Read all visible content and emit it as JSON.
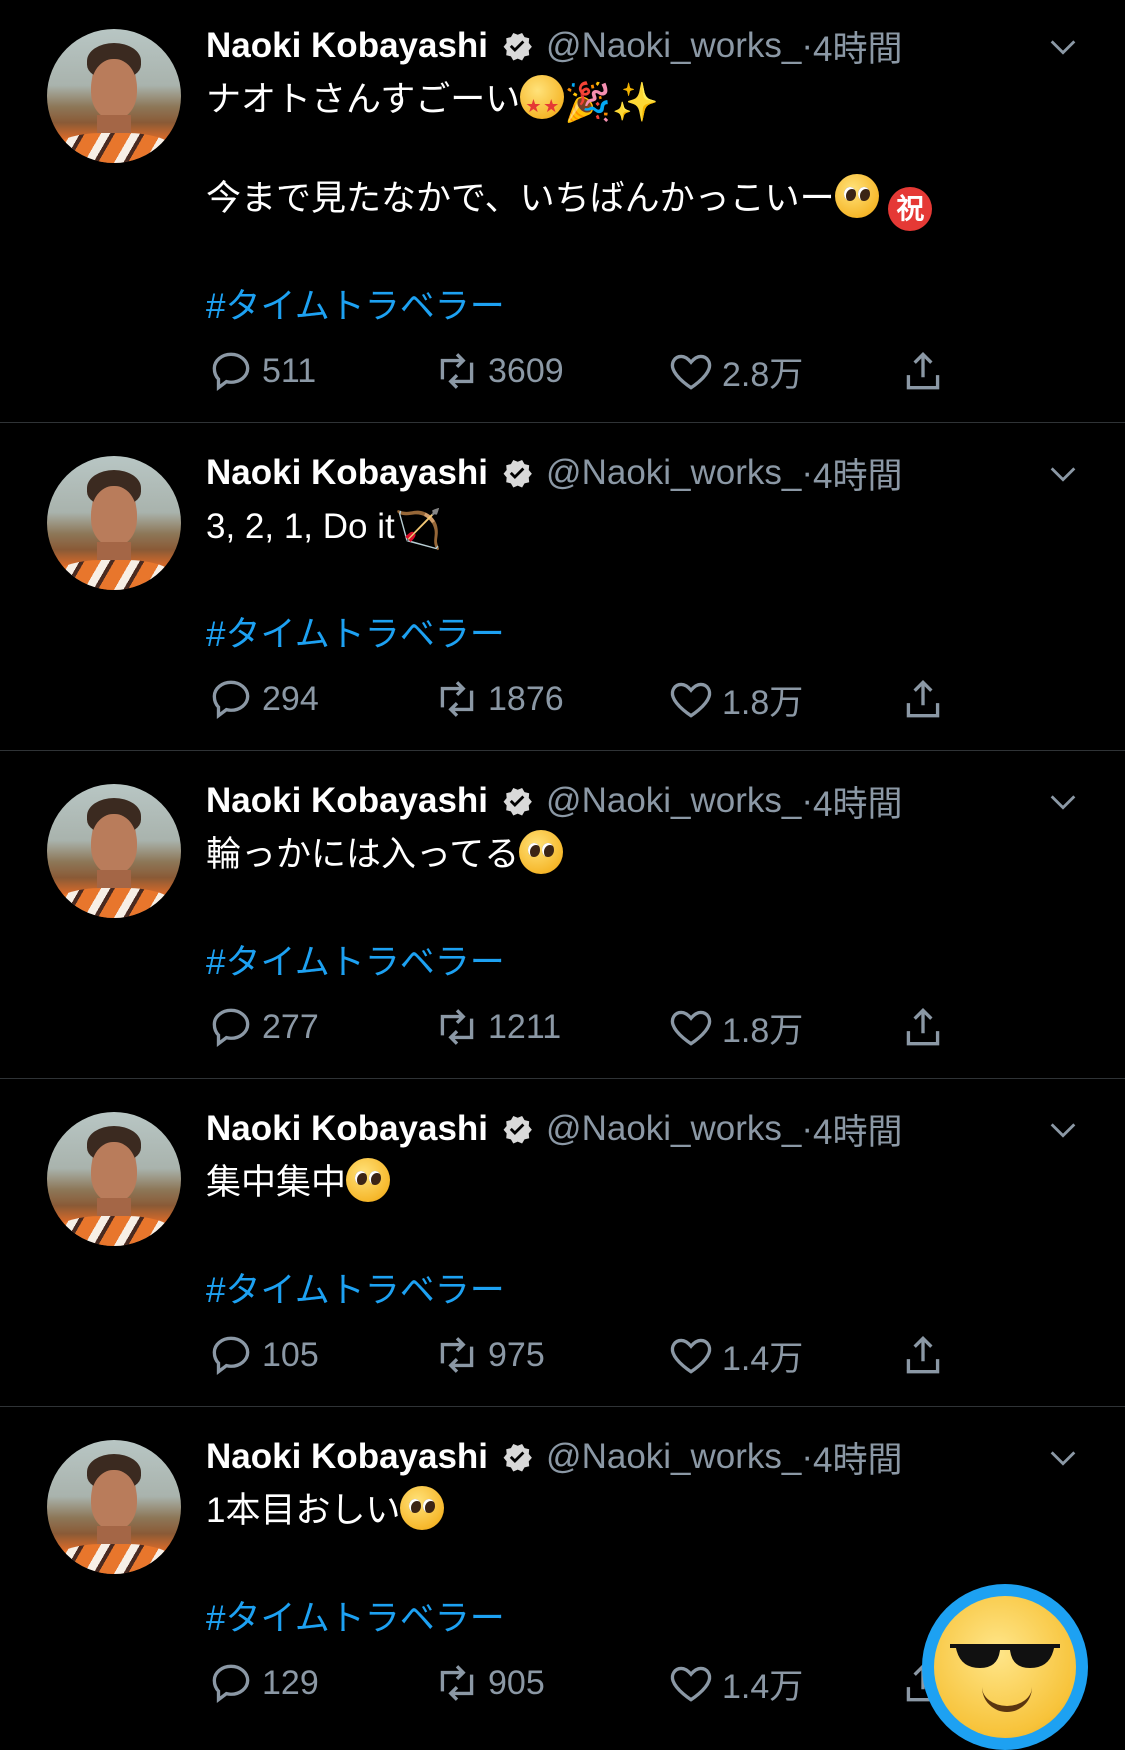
{
  "author": {
    "name": "Naoki Kobayashi",
    "handle": "@Naoki_works_",
    "time_sep": " · ",
    "time": "4時間"
  },
  "tweets": [
    {
      "line1": "ナオトさんすごーい",
      "line2": "今まで見たなかで、いちばんかっこいー",
      "hashtag": "#タイムトラベラー",
      "replies": "511",
      "retweets": "3609",
      "likes": "2.8万"
    },
    {
      "line1": "3, 2, 1, Do it",
      "hashtag": "#タイムトラベラー",
      "replies": "294",
      "retweets": "1876",
      "likes": "1.8万"
    },
    {
      "line1": "輪っかには入ってる",
      "hashtag": "#タイムトラベラー",
      "replies": "277",
      "retweets": "1211",
      "likes": "1.8万"
    },
    {
      "line1": "集中集中",
      "hashtag": "#タイムトラベラー",
      "replies": "105",
      "retweets": "975",
      "likes": "1.4万"
    },
    {
      "line1": "1本目おしい",
      "hashtag": "#タイムトラベラー",
      "replies": "129",
      "retweets": "905",
      "likes": "1.4万"
    }
  ],
  "emoji_labels": {
    "shuku": "祝",
    "sparkles": "✨",
    "party": "🎉",
    "bow": "🏹"
  },
  "colors": {
    "background": "#000000",
    "text": "#ffffff",
    "secondary": "#8b98a5",
    "hashtag": "#1da1f2",
    "divider": "#2f3336"
  }
}
